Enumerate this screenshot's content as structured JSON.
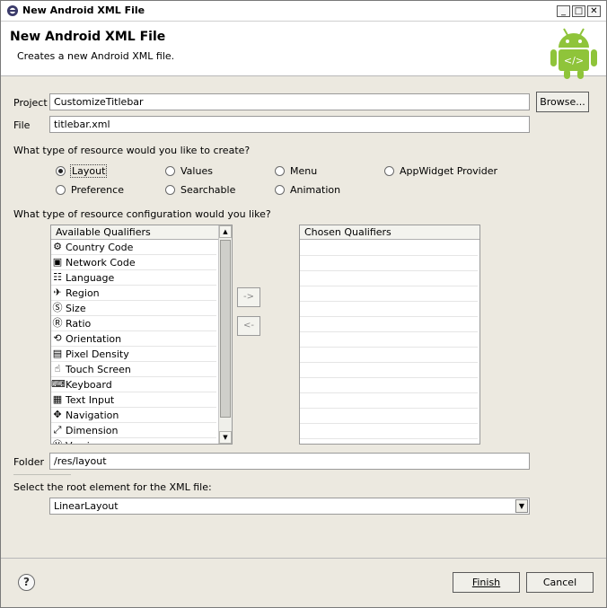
{
  "window": {
    "title": "New Android XML File",
    "controls": {
      "minimize": "_",
      "maximize": "□",
      "close": "✕"
    }
  },
  "header": {
    "title": "New Android XML File",
    "description": "Creates a new Android XML file.",
    "logo_icon": "android-robot-icon"
  },
  "project": {
    "label": "Project",
    "value": "CustomizeTitlebar",
    "browse": "Browse..."
  },
  "file": {
    "label": "File",
    "value": "titlebar.xml"
  },
  "resource_type": {
    "question": "What type of resource would you like to create?",
    "options": [
      "Layout",
      "Values",
      "Menu",
      "AppWidget Provider",
      "Preference",
      "Searchable",
      "Animation"
    ],
    "selected": "Layout"
  },
  "qualifiers": {
    "question": "What type of resource configuration would you like?",
    "available_header": "Available Qualifiers",
    "chosen_header": "Chosen Qualifiers",
    "available": [
      {
        "label": "Country Code",
        "icon": "country-code-icon"
      },
      {
        "label": "Network Code",
        "icon": "network-code-icon"
      },
      {
        "label": "Language",
        "icon": "language-icon"
      },
      {
        "label": "Region",
        "icon": "region-icon"
      },
      {
        "label": "Size",
        "icon": "size-icon"
      },
      {
        "label": "Ratio",
        "icon": "ratio-icon"
      },
      {
        "label": "Orientation",
        "icon": "orientation-icon"
      },
      {
        "label": "Pixel Density",
        "icon": "pixel-density-icon"
      },
      {
        "label": "Touch Screen",
        "icon": "touch-screen-icon"
      },
      {
        "label": "Keyboard",
        "icon": "keyboard-icon"
      },
      {
        "label": "Text Input",
        "icon": "text-input-icon"
      },
      {
        "label": "Navigation",
        "icon": "navigation-icon"
      },
      {
        "label": "Dimension",
        "icon": "dimension-icon"
      },
      {
        "label": "Version",
        "icon": "version-icon"
      }
    ],
    "add_button": "->",
    "remove_button": "<-"
  },
  "folder": {
    "label": "Folder",
    "value": "/res/layout"
  },
  "root_element": {
    "question": "Select the root element for the XML file:",
    "value": "LinearLayout"
  },
  "buttons": {
    "help": "?",
    "finish": "Finish",
    "cancel": "Cancel"
  }
}
